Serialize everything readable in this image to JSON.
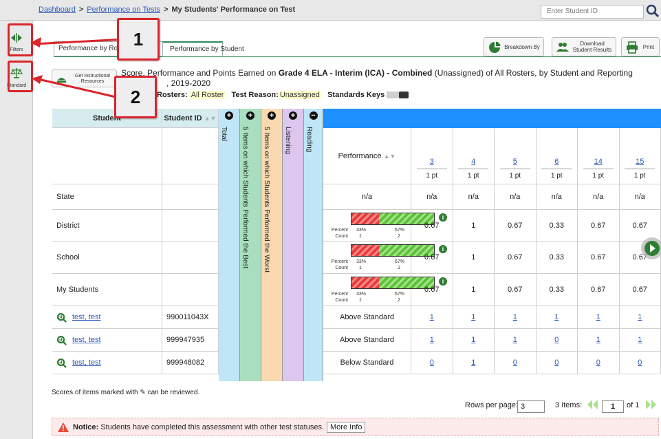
{
  "breadcrumb": {
    "dashboard": "Dashboard",
    "performance_on_tests": "Performance on Tests",
    "current": "My Students' Performance on Test",
    "sep": ">"
  },
  "search": {
    "placeholder": "Enter Student ID"
  },
  "sidebar": {
    "filters_label": "Filters",
    "standard_label": "Standard"
  },
  "callouts": {
    "one": "1",
    "two": "2"
  },
  "tabs": {
    "by_roster": "Performance by Roster",
    "by_student": "Performance by Student"
  },
  "toolbar": {
    "breakdown": "Breakdown By",
    "download_line1": "Download",
    "download_line2": "Student Results",
    "print": "Print"
  },
  "instructional": {
    "line1": "Get Instructional",
    "line2": "Resources"
  },
  "heading": {
    "prefix": "Score, Performance and Points Earned on",
    "test": "Grade 4 ELA - Interim (ICA) - Combined",
    "suffix": "(Unassigned) of All Rosters, by Student and Reporting",
    "year": ", 2019-2020"
  },
  "filters": {
    "rosters_label": "Rosters:",
    "rosters_value": "All Roster",
    "reason_label": "Test Reason:",
    "reason_value": "Unassigned",
    "keys_label": "Standards Keys"
  },
  "table": {
    "col_student": "Student",
    "col_student_id": "Student ID",
    "cat_total": "Total",
    "cat_best": "5 Items on which Students Performed the Best",
    "cat_worst": "5 Items on which Students Performed the Worst",
    "cat_listening": "Listening",
    "cat_reading": "Reading",
    "col_performance": "Performance",
    "items": [
      {
        "num": "3",
        "pts": "1 pt"
      },
      {
        "num": "4",
        "pts": "1 pt"
      },
      {
        "num": "5",
        "pts": "1 pt"
      },
      {
        "num": "6",
        "pts": "1 pt"
      },
      {
        "num": "14",
        "pts": "1 pt"
      },
      {
        "num": "15",
        "pts": "1 pt"
      }
    ],
    "agg_rows": [
      {
        "name": "State",
        "perf": "n/a",
        "vals": [
          "n/a",
          "n/a",
          "n/a",
          "n/a",
          "n/a",
          "n/a"
        ]
      },
      {
        "name": "District",
        "pct_label": "Percent",
        "count_label": "Count",
        "pct_low": "33%",
        "pct_high": "67%",
        "cnt_low": "1",
        "cnt_high": "2",
        "low_share": 0.33,
        "vals": [
          "0.67",
          "1",
          "0.67",
          "0.33",
          "0.67",
          "0.67"
        ]
      },
      {
        "name": "School",
        "pct_label": "Percent",
        "count_label": "Count",
        "pct_low": "33%",
        "pct_high": "67%",
        "cnt_low": "1",
        "cnt_high": "2",
        "low_share": 0.33,
        "vals": [
          "0.67",
          "1",
          "0.67",
          "0.33",
          "0.67",
          "0.67"
        ]
      },
      {
        "name": "My Students",
        "pct_label": "Percent",
        "count_label": "Count",
        "pct_low": "33%",
        "pct_high": "67%",
        "cnt_low": "1",
        "cnt_high": "2",
        "low_share": 0.33,
        "vals": [
          "0.67",
          "1",
          "0.67",
          "0.33",
          "0.67",
          "0.67"
        ]
      }
    ],
    "students": [
      {
        "name": "test, test",
        "id": "990011043X",
        "perf": "Above Standard",
        "vals": [
          "1",
          "1",
          "1",
          "1",
          "1",
          "1"
        ]
      },
      {
        "name": "test, test",
        "id": "999947935",
        "perf": "Above Standard",
        "vals": [
          "1",
          "1",
          "1",
          "0",
          "1",
          "1"
        ]
      },
      {
        "name": "test, test",
        "id": "999948082",
        "perf": "Below Standard",
        "vals": [
          "0",
          "1",
          "0",
          "0",
          "0",
          "0"
        ]
      }
    ]
  },
  "footer": {
    "note_pre": "Scores of items marked with",
    "note_post": "can be reviewed.",
    "rows_label": "Rows per page:",
    "rows_value": "3",
    "items_count": "3",
    "items_label": "Items:",
    "page_value": "1",
    "of_label": "of 1"
  },
  "notice": {
    "label": "Notice:",
    "text": "Students have completed this assessment with other test statuses.",
    "more": "More Info"
  },
  "colors": {
    "tab_green": "#2e8b57",
    "header_blue": "#1e90ff",
    "callout_red": "#d9252b"
  }
}
